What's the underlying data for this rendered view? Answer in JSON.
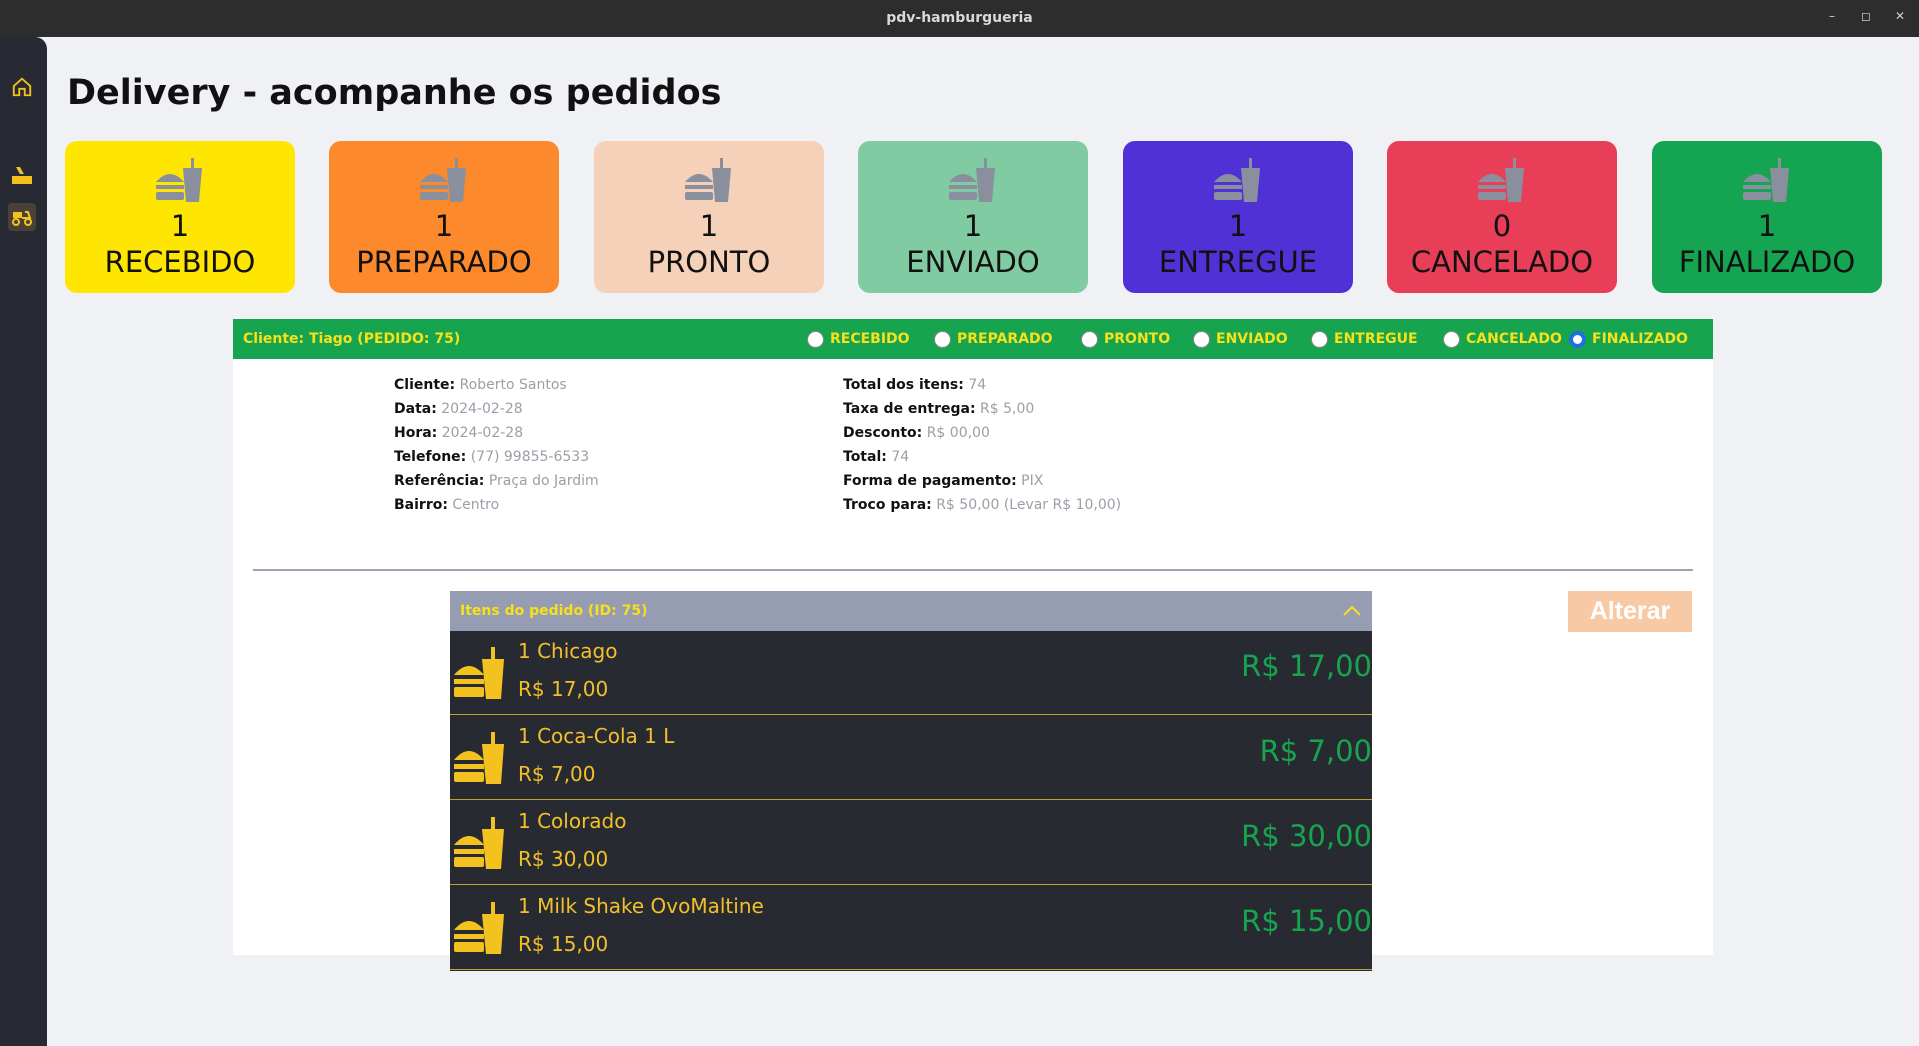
{
  "window": {
    "title": "pdv-hamburgueria",
    "minimize": "–",
    "maximize": "◻",
    "close": "✕"
  },
  "sidebar": {
    "items": [
      {
        "icon": "home-icon"
      },
      {
        "icon": "orders-icon"
      },
      {
        "icon": "delivery-icon"
      }
    ]
  },
  "page": {
    "title": "Delivery - acompanhe os pedidos"
  },
  "colors": {
    "recebido": "#ffe600",
    "preparado": "#fd892d",
    "pronto": "#f6d1b9",
    "enviado": "#80cba2",
    "entregue": "#5031d6",
    "cancelado": "#e83e58",
    "finalizado": "#15a452",
    "header_green": "#17a44f",
    "label_yellow": "#f7e11a"
  },
  "cards": [
    {
      "count": "1",
      "label": "RECEBIDO"
    },
    {
      "count": "1",
      "label": "PREPARADO"
    },
    {
      "count": "1",
      "label": "PRONTO"
    },
    {
      "count": "1",
      "label": "ENVIADO"
    },
    {
      "count": "1",
      "label": "ENTREGUE"
    },
    {
      "count": "0",
      "label": "CANCELADO"
    },
    {
      "count": "1",
      "label": "FINALIZADO"
    }
  ],
  "order": {
    "header": "Cliente: Tiago (PEDIDO: 75)",
    "status_options": [
      "RECEBIDO",
      "PREPARADO",
      "PRONTO",
      "ENVIADO",
      "ENTREGUE",
      "CANCELADO",
      "FINALIZADO"
    ],
    "selected_status": "FINALIZADO",
    "left": [
      {
        "label": "Cliente:",
        "value": "Roberto Santos"
      },
      {
        "label": "Data:",
        "value": "2024-02-28"
      },
      {
        "label": "Hora:",
        "value": "2024-02-28"
      },
      {
        "label": "Telefone:",
        "value": "(77) 99855-6533"
      },
      {
        "label": "Referência:",
        "value": "Praça do Jardim"
      },
      {
        "label": "Bairro:",
        "value": "Centro"
      }
    ],
    "right": [
      {
        "label": "Total dos itens:",
        "value": "74"
      },
      {
        "label": "Taxa de entrega:",
        "value": "R$ 5,00"
      },
      {
        "label": "Desconto:",
        "value": "R$ 00,00"
      },
      {
        "label": "Total:",
        "value": "74"
      },
      {
        "label": "Forma de pagamento:",
        "value": "PIX"
      },
      {
        "label": "Troco para:",
        "value": "R$ 50,00 (Levar R$ 10,00)"
      }
    ],
    "items_title": "Itens do pedido (ID: 75)",
    "items": [
      {
        "name": "1 Chicago",
        "unit_price": "R$ 17,00",
        "total": "R$ 17,00"
      },
      {
        "name": "1 Coca-Cola 1 L",
        "unit_price": "R$ 7,00",
        "total": "R$ 7,00"
      },
      {
        "name": "1 Colorado",
        "unit_price": "R$ 30,00",
        "total": "R$ 30,00"
      },
      {
        "name": "1 Milk Shake OvoMaltine",
        "unit_price": "R$ 15,00",
        "total": "R$ 15,00"
      }
    ],
    "alterar_label": "Alterar"
  }
}
